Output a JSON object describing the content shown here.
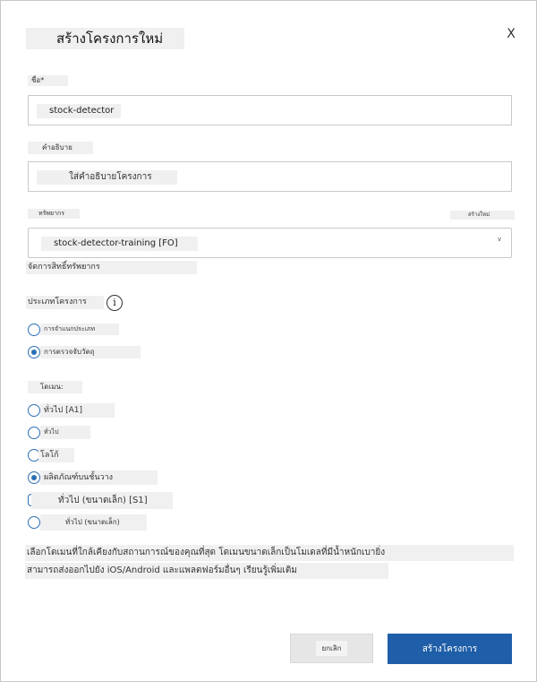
{
  "dialog": {
    "title": "สร้างโครงการใหม่",
    "close_label": "X"
  },
  "name": {
    "label": "ชื่อ*",
    "value": "stock-detector"
  },
  "description": {
    "label": "คำอธิบาย",
    "placeholder": "ใส่คำอธิบายโครงการ"
  },
  "resource": {
    "label": "ทรัพยากร",
    "create_new": "สร้างใหม่",
    "selected": "stock-detector-training [FO]",
    "chevron": "v",
    "manage_link": "จัดการสิทธิ์ทรัพยากร"
  },
  "project_type": {
    "label": "ประเภทโครงการ",
    "info_icon": "i",
    "options": [
      {
        "label": "การจำแนกประเภท",
        "selected": false
      },
      {
        "label": "การตรวจจับวัตถุ",
        "selected": true
      }
    ]
  },
  "domain": {
    "label": "โดเมน:",
    "options": [
      {
        "label": "ทั่วไป [A1]",
        "selected": false
      },
      {
        "label": "ทั่วไป",
        "selected": false
      },
      {
        "label": "โลโก้",
        "selected": false
      },
      {
        "label": "ผลิตภัณฑ์บนชั้นวาง",
        "selected": true
      },
      {
        "label": "ทั่วไป (ขนาดเล็ก) [S1]",
        "selected": false
      },
      {
        "label": "ทั่วไป (ขนาดเล็ก)",
        "selected": false
      }
    ],
    "help_line1": "เลือกโดเมนที่ใกล้เคียงกับสถานการณ์ของคุณที่สุด โดเมนขนาดเล็กเป็นโมเดลที่มีน้ำหนักเบายิ่ง",
    "help_line2": "สามารถส่งออกไปยัง iOS/Android และแพลตฟอร์มอื่นๆ เรียนรู้เพิ่มเติม"
  },
  "footer": {
    "cancel_label": "ยกเลิก",
    "create_label": "สร้างโครงการ"
  },
  "colors": {
    "accent": "#1f5ea8",
    "radio": "#2a6fb5"
  }
}
